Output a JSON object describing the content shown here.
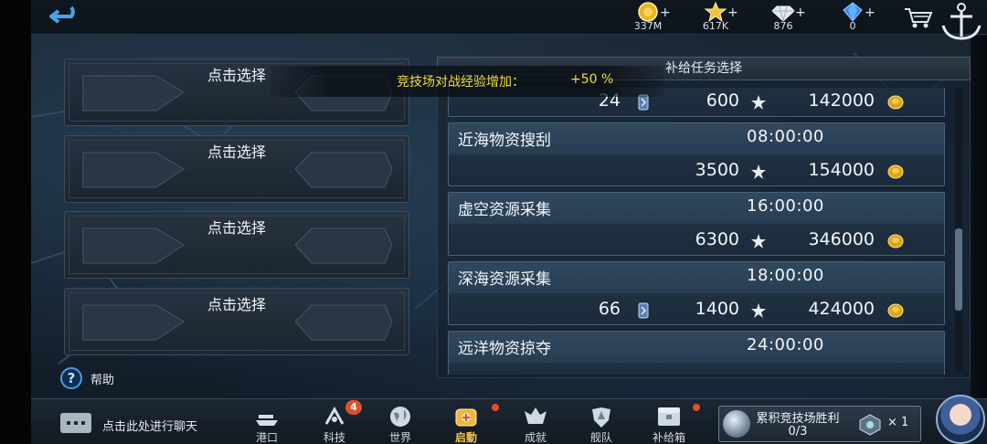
{
  "topbar": {
    "resources": [
      {
        "icon": "gold-coin-icon",
        "value": "337M",
        "plus": "+"
      },
      {
        "icon": "star-icon",
        "value": "617K",
        "plus": "+"
      },
      {
        "icon": "diamond-icon",
        "value": "876",
        "plus": "+"
      },
      {
        "icon": "crystal-icon",
        "value": "0",
        "plus": "+"
      }
    ],
    "cart_icon": "shopping-cart-icon",
    "anchor_icon": "anchor-icon",
    "back_icon": "back-arrow-icon"
  },
  "slots": [
    {
      "label": "点击选择"
    },
    {
      "label": "点击选择"
    },
    {
      "label": "点击选择"
    },
    {
      "label": "点击选择"
    }
  ],
  "toast": {
    "text": "竞技场对战经验增加：",
    "value": "+50 %"
  },
  "panel": {
    "title": "补给任务选择",
    "missions": [
      {
        "name": "",
        "time": "",
        "ticket": "24",
        "stars": "600",
        "gold": "142000"
      },
      {
        "name": "近海物资搜刮",
        "time": "08:00:00",
        "ticket": "",
        "stars": "3500",
        "gold": "154000"
      },
      {
        "name": "虚空资源采集",
        "time": "16:00:00",
        "ticket": "",
        "stars": "6300",
        "gold": "346000"
      },
      {
        "name": "深海资源采集",
        "time": "18:00:00",
        "ticket": "66",
        "stars": "1400",
        "gold": "424000"
      },
      {
        "name": "远洋物资掠夺",
        "time": "24:00:00",
        "ticket": "",
        "stars": "",
        "gold": ""
      }
    ]
  },
  "help": {
    "label": "帮助",
    "icon": "question-icon"
  },
  "chat": {
    "label": "点击此处进行聊天",
    "icon": "chat-bubble-icon"
  },
  "nav": [
    {
      "label": "港口",
      "icon": "harbor-icon",
      "badge": ""
    },
    {
      "label": "科技",
      "icon": "tech-icon",
      "badge": "4"
    },
    {
      "label": "世界",
      "icon": "globe-icon",
      "badge": ""
    },
    {
      "label": "启動",
      "icon": "launch-icon",
      "badge": "",
      "active": true
    },
    {
      "label": "成就",
      "icon": "achievement-icon",
      "badge": ""
    },
    {
      "label": "舰队",
      "icon": "fleet-icon",
      "badge": ""
    },
    {
      "label": "补给箱",
      "icon": "supply-box-icon",
      "badge": ""
    }
  ],
  "arena": {
    "title": "累积竞技场胜利",
    "progress": "0/3",
    "multiplier": "× 1"
  },
  "colors": {
    "toast_yellow": "#f3dc39",
    "badge_red": "#e0502a",
    "active_nav": "#f6c34a"
  }
}
